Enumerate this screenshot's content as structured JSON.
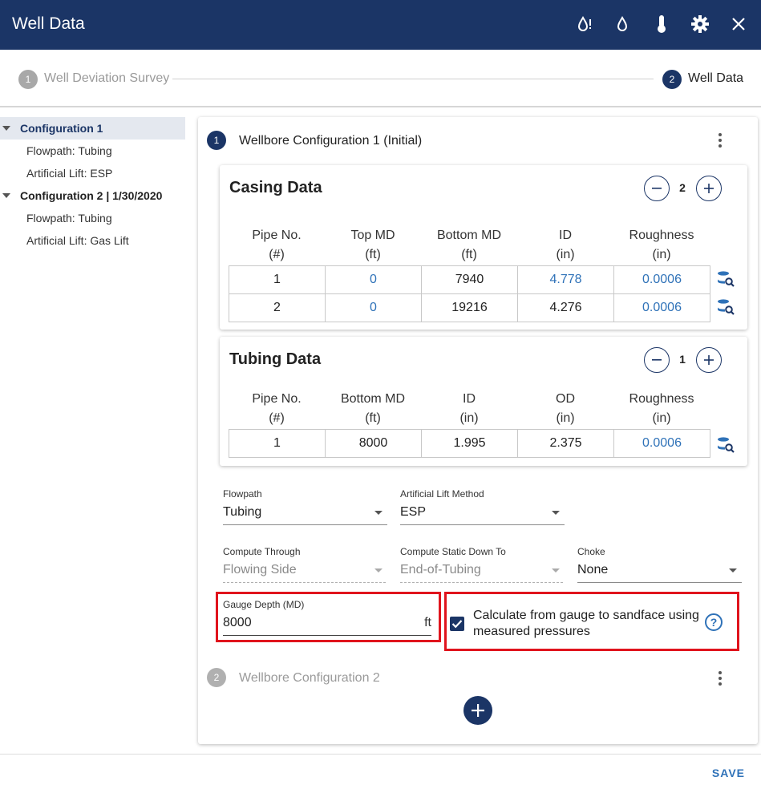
{
  "header": {
    "title": "Well Data",
    "icons": [
      "drop-alert-icon",
      "drop-icon",
      "thermometer-icon",
      "gear-icon",
      "close-icon"
    ]
  },
  "stepper": {
    "steps": [
      {
        "num": "1",
        "label": "Well Deviation Survey",
        "active": false
      },
      {
        "num": "2",
        "label": "Well Data",
        "active": true
      }
    ]
  },
  "tree": {
    "config1": {
      "label": "Configuration 1",
      "children": [
        "Flowpath: Tubing",
        "Artificial Lift: ESP"
      ]
    },
    "config2": {
      "label": "Configuration 2 | 1/30/2020",
      "children": [
        "Flowpath: Tubing",
        "Artificial Lift: Gas Lift"
      ]
    }
  },
  "wellbore1": {
    "num": "1",
    "title": "Wellbore Configuration 1 (Initial)",
    "casing": {
      "title": "Casing Data",
      "count": "2",
      "headers": [
        {
          "name": "Pipe No.",
          "unit": "(#)"
        },
        {
          "name": "Top MD",
          "unit": "(ft)"
        },
        {
          "name": "Bottom MD",
          "unit": "(ft)"
        },
        {
          "name": "ID",
          "unit": "(in)"
        },
        {
          "name": "Roughness",
          "unit": "(in)"
        }
      ],
      "rows": [
        [
          "1",
          "0",
          "7940",
          "4.778",
          "0.0006"
        ],
        [
          "2",
          "0",
          "19216",
          "4.276",
          "0.0006"
        ]
      ]
    },
    "tubing": {
      "title": "Tubing Data",
      "count": "1",
      "headers": [
        {
          "name": "Pipe No.",
          "unit": "(#)"
        },
        {
          "name": "Bottom MD",
          "unit": "(ft)"
        },
        {
          "name": "ID",
          "unit": "(in)"
        },
        {
          "name": "OD",
          "unit": "(in)"
        },
        {
          "name": "Roughness",
          "unit": "(in)"
        }
      ],
      "rows": [
        [
          "1",
          "8000",
          "1.995",
          "2.375",
          "0.0006"
        ]
      ]
    },
    "fields": {
      "flowpath": {
        "label": "Flowpath",
        "value": "Tubing"
      },
      "lift": {
        "label": "Artificial Lift Method",
        "value": "ESP"
      },
      "compute_through": {
        "label": "Compute Through",
        "value": "Flowing Side"
      },
      "compute_static": {
        "label": "Compute Static Down To",
        "value": "End-of-Tubing"
      },
      "choke": {
        "label": "Choke",
        "value": "None"
      },
      "gauge": {
        "label": "Gauge Depth (MD)",
        "value": "8000",
        "unit": "ft"
      }
    },
    "calc_checkbox": {
      "line1": "Calculate from gauge to sandface using",
      "line2": "measured pressures",
      "checked": true
    }
  },
  "wellbore2": {
    "num": "2",
    "title": "Wellbore Configuration 2"
  },
  "footer": {
    "save_label": "SAVE"
  },
  "colors": {
    "navy": "#1b3566",
    "link_blue": "#2f72b8",
    "highlight_red": "#e0141d"
  }
}
